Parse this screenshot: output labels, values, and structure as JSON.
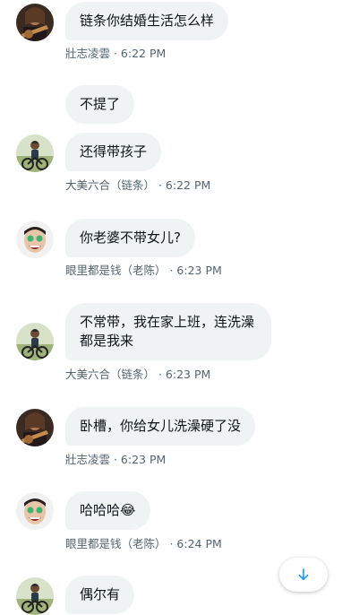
{
  "messages": [
    {
      "text": "链条你结婚生活怎么样",
      "meta": "壯志凌雲 · 6:22 PM",
      "avatar": "guitar-avatar"
    },
    {
      "text": "不提了",
      "meta": "",
      "avatar": ""
    },
    {
      "text": "还得带孩子",
      "meta": "大美六合（链条） · 6:22 PM",
      "avatar": "cyclist-avatar"
    },
    {
      "text": "你老婆不带女儿?",
      "meta": "眼里都是钱（老陈） · 6:23 PM",
      "avatar": "laughing-face-avatar"
    },
    {
      "text": "不常带，我在家上班，连洗澡都是我来",
      "meta": "大美六合（链条） · 6:23 PM",
      "avatar": "cyclist-avatar"
    },
    {
      "text": "卧槽，你给女儿洗澡硬了没",
      "meta": "壯志凌雲 · 6:23 PM",
      "avatar": "guitar-avatar"
    },
    {
      "text": "哈哈哈😂",
      "meta": "眼里都是钱（老陈） · 6:24 PM",
      "avatar": "laughing-face-avatar"
    },
    {
      "text": "偶尔有",
      "meta": "",
      "avatar": "cyclist-avatar"
    }
  ],
  "colors": {
    "bubble_bg": "#eff3f4",
    "meta_text": "#536471",
    "accent": "#1d9bf0"
  },
  "scroll_button": {
    "icon": "arrow-down-icon"
  }
}
